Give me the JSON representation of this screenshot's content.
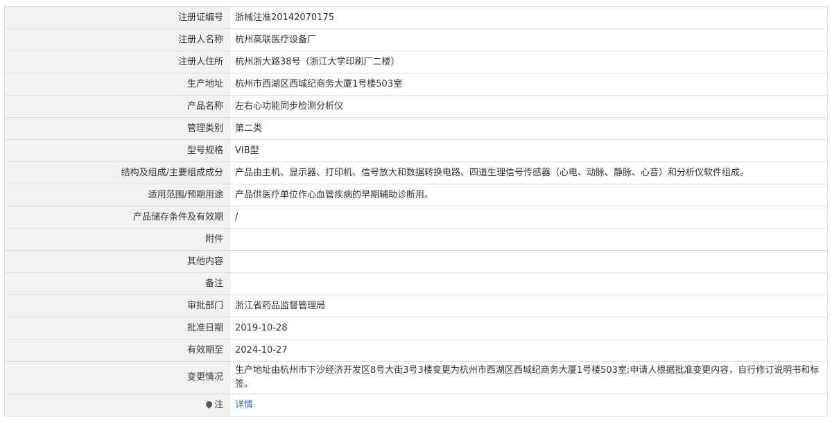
{
  "rows": [
    {
      "label": "注册证编号",
      "value": "浙械注准20142070175"
    },
    {
      "label": "注册人名称",
      "value": "杭州高联医疗设备厂"
    },
    {
      "label": "注册人住所",
      "value": "杭州浙大路38号（浙江大学印刷厂二楼）"
    },
    {
      "label": "生产地址",
      "value": "杭州市西湖区西城纪商务大厦1号楼503室"
    },
    {
      "label": "产品名称",
      "value": "左右心功能同步检测分析仪"
    },
    {
      "label": "管理类别",
      "value": "第二类"
    },
    {
      "label": "型号规格",
      "value": "VIB型"
    },
    {
      "label": "结构及组成/主要组成成分",
      "value": "产品由主机、显示器、打印机、信号放大和数据转换电路、四道生理信号传感器（心电、动脉、静脉、心音）和分析仪软件组成。"
    },
    {
      "label": "适用范围/预期用途",
      "value": "产品供医疗单位作心血管疾病的早期辅助诊断用。"
    },
    {
      "label": "产品储存条件及有效期",
      "value": "/"
    },
    {
      "label": "附件",
      "value": ""
    },
    {
      "label": "其他内容",
      "value": ""
    },
    {
      "label": "备注",
      "value": ""
    },
    {
      "label": "审批部门",
      "value": "浙江省药品监督管理局"
    },
    {
      "label": "批准日期",
      "value": "2019-10-28"
    },
    {
      "label": "有效期至",
      "value": "2024-10-27"
    },
    {
      "label": "变更情况",
      "value": "生产地址由杭州市下沙经济开发区8号大街3号3楼变更为杭州市西湖区西城纪商务大厦1号楼503室;申请人根据批准变更内容，自行修订说明书和标签。"
    }
  ],
  "note": {
    "label": "注",
    "link_text": "详情",
    "icon": "pin-icon"
  }
}
